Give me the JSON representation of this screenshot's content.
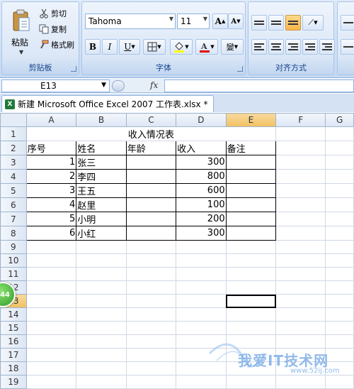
{
  "ribbon": {
    "clipboard": {
      "paste_label": "粘贴",
      "cut_label": "剪切",
      "copy_label": "复制",
      "format_painter_label": "格式刷",
      "group_label": "剪贴板"
    },
    "font": {
      "font_name": "Tahoma",
      "font_size": "11",
      "grow_label": "A",
      "shrink_label": "A",
      "bold_label": "B",
      "italic_label": "I",
      "underline_label": "U",
      "phonetic_label": "變",
      "group_label": "字体",
      "font_color": "#e00000",
      "fill_color": "#ffff00"
    },
    "alignment": {
      "group_label": "对齐方式"
    }
  },
  "formula_bar": {
    "name_box": "E13",
    "fx_label": "fx",
    "value": ""
  },
  "workbook": {
    "tab_title": "新建 Microsoft Office Excel 2007 工作表.xlsx *"
  },
  "sheet": {
    "columns": [
      "A",
      "B",
      "C",
      "D",
      "E",
      "F",
      "G"
    ],
    "rows": [
      "1",
      "2",
      "3",
      "4",
      "5",
      "6",
      "7",
      "8",
      "9",
      "10",
      "11",
      "12",
      "13",
      "14",
      "15",
      "16",
      "17",
      "18",
      "19"
    ],
    "title": "收入情况表",
    "headers": [
      "序号",
      "姓名",
      "年龄",
      "收入",
      "备注"
    ],
    "data": [
      {
        "no": "1",
        "name": "张三",
        "age": "",
        "income": "300",
        "note": ""
      },
      {
        "no": "2",
        "name": "李四",
        "age": "",
        "income": "800",
        "note": ""
      },
      {
        "no": "3",
        "name": "王五",
        "age": "",
        "income": "600",
        "note": ""
      },
      {
        "no": "4",
        "name": "赵里",
        "age": "",
        "income": "100",
        "note": ""
      },
      {
        "no": "5",
        "name": "小明",
        "age": "",
        "income": "200",
        "note": ""
      },
      {
        "no": "6",
        "name": "小红",
        "age": "",
        "income": "300",
        "note": ""
      }
    ],
    "selected_cell": "E13"
  },
  "badge": {
    "label": "44"
  },
  "watermark": {
    "text": "我爱IT技术网",
    "url": "www.52ij.com"
  }
}
